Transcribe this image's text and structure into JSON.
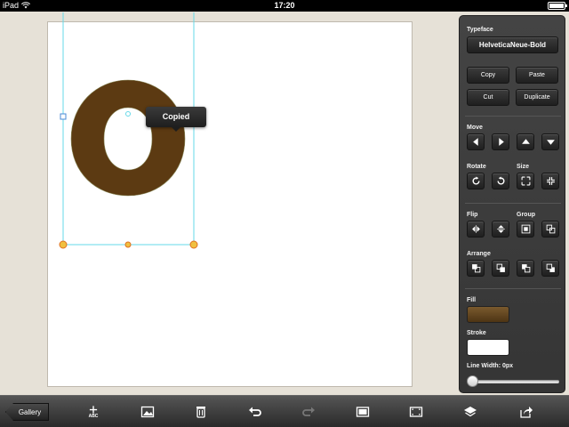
{
  "status_bar": {
    "carrier": "iPad",
    "time": "17:20"
  },
  "canvas": {
    "glyph_text": "O",
    "glyph_fill": "#5c3a12",
    "selection_color": "#66d9e8",
    "tooltip": "Copied"
  },
  "panel": {
    "typeface_label": "Typeface",
    "typeface_value": "HelveticaNeue-Bold",
    "copy": "Copy",
    "paste": "Paste",
    "cut": "Cut",
    "duplicate": "Duplicate",
    "move_label": "Move",
    "rotate_label": "Rotate",
    "size_label": "Size",
    "flip_label": "Flip",
    "group_label": "Group",
    "arrange_label": "Arrange",
    "fill_label": "Fill",
    "fill_color": "#6b4a20",
    "stroke_label": "Stroke",
    "stroke_color": "#ffffff",
    "line_width_label": "Line Width: 0px",
    "line_width_value": 0
  },
  "toolbar": {
    "gallery": "Gallery",
    "add_text_sub": "ABC",
    "icons": [
      "add-text-icon",
      "image-icon",
      "trash-icon",
      "undo-icon",
      "redo-icon",
      "artboard-icon",
      "fit-icon",
      "layers-icon",
      "share-icon"
    ]
  }
}
